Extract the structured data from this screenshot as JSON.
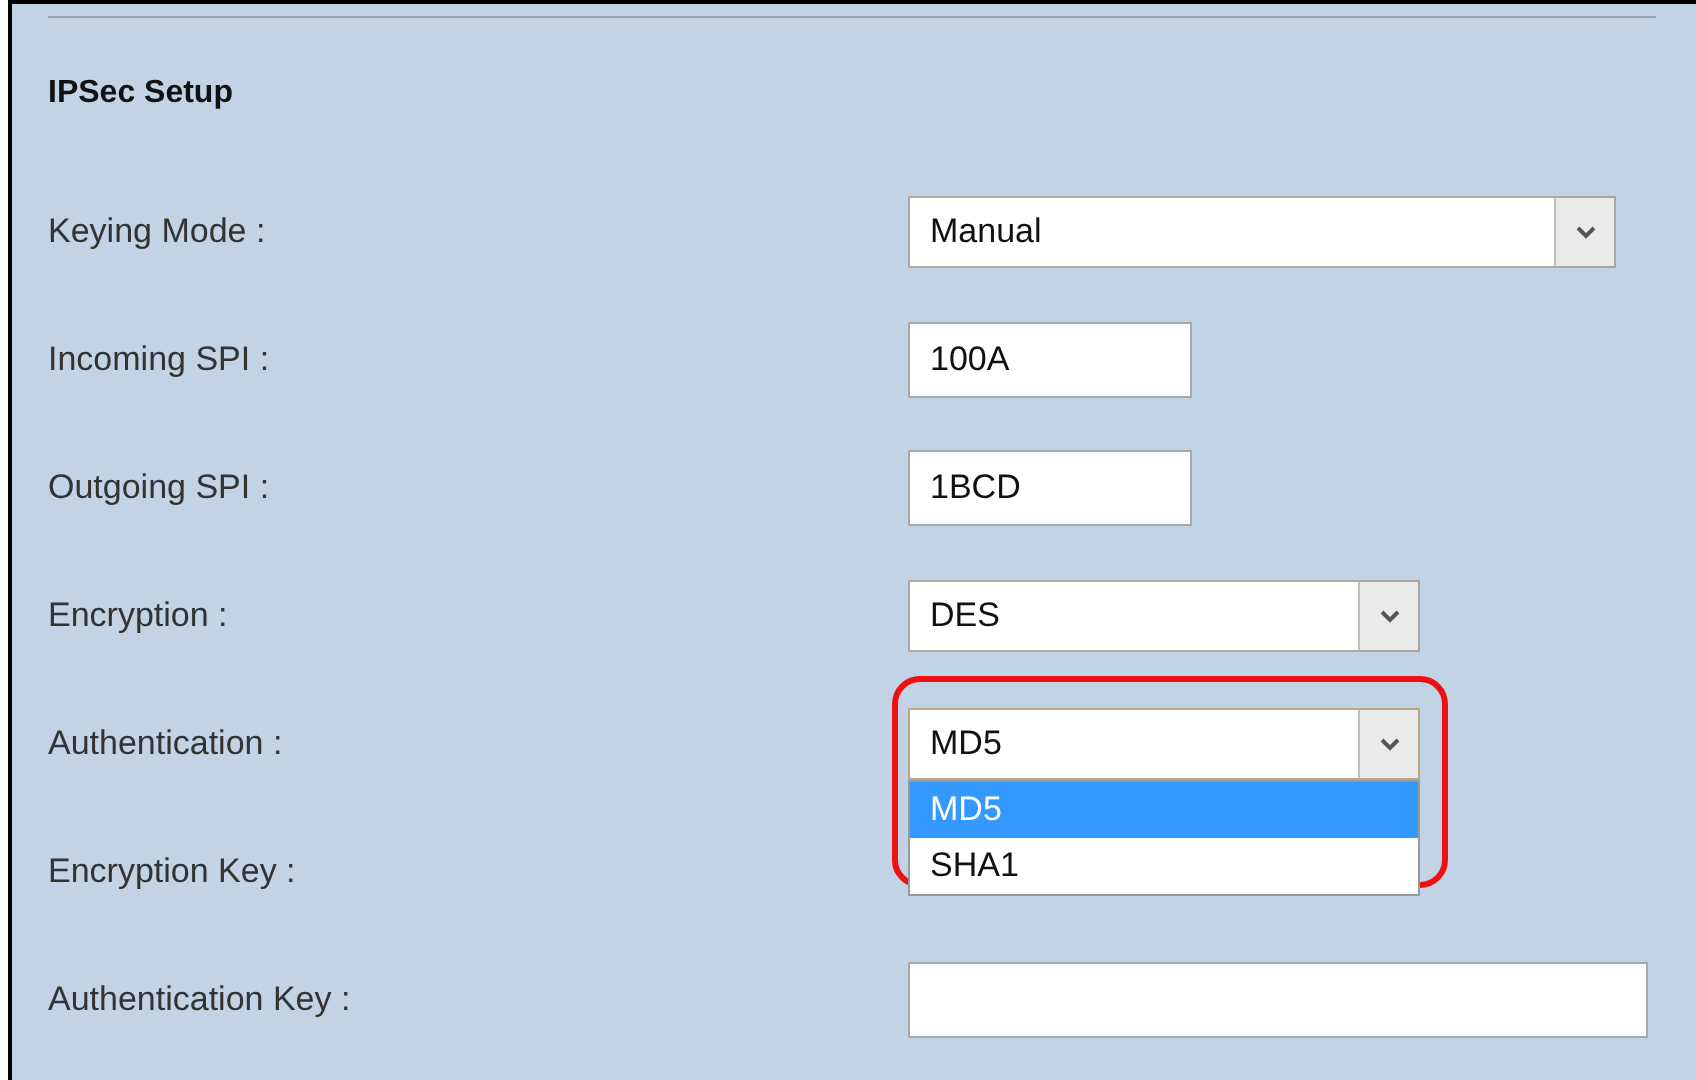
{
  "section": {
    "title": "IPSec Setup"
  },
  "fields": [
    {
      "label": "Keying Mode :",
      "kind": "select",
      "value": "Manual"
    },
    {
      "label": "Incoming SPI :",
      "kind": "text",
      "value": "100A"
    },
    {
      "label": "Outgoing SPI :",
      "kind": "text",
      "value": "1BCD"
    },
    {
      "label": "Encryption :",
      "kind": "select",
      "value": "DES"
    },
    {
      "label": "Authentication :",
      "kind": "select",
      "value": "MD5",
      "highlighted": true,
      "expanded": true,
      "options": [
        {
          "label": "MD5",
          "selected": true
        },
        {
          "label": "SHA1",
          "selected": false
        }
      ]
    },
    {
      "label": "Encryption Key :",
      "kind": "covered"
    },
    {
      "label": "Authentication Key :",
      "kind": "text"
    }
  ]
}
